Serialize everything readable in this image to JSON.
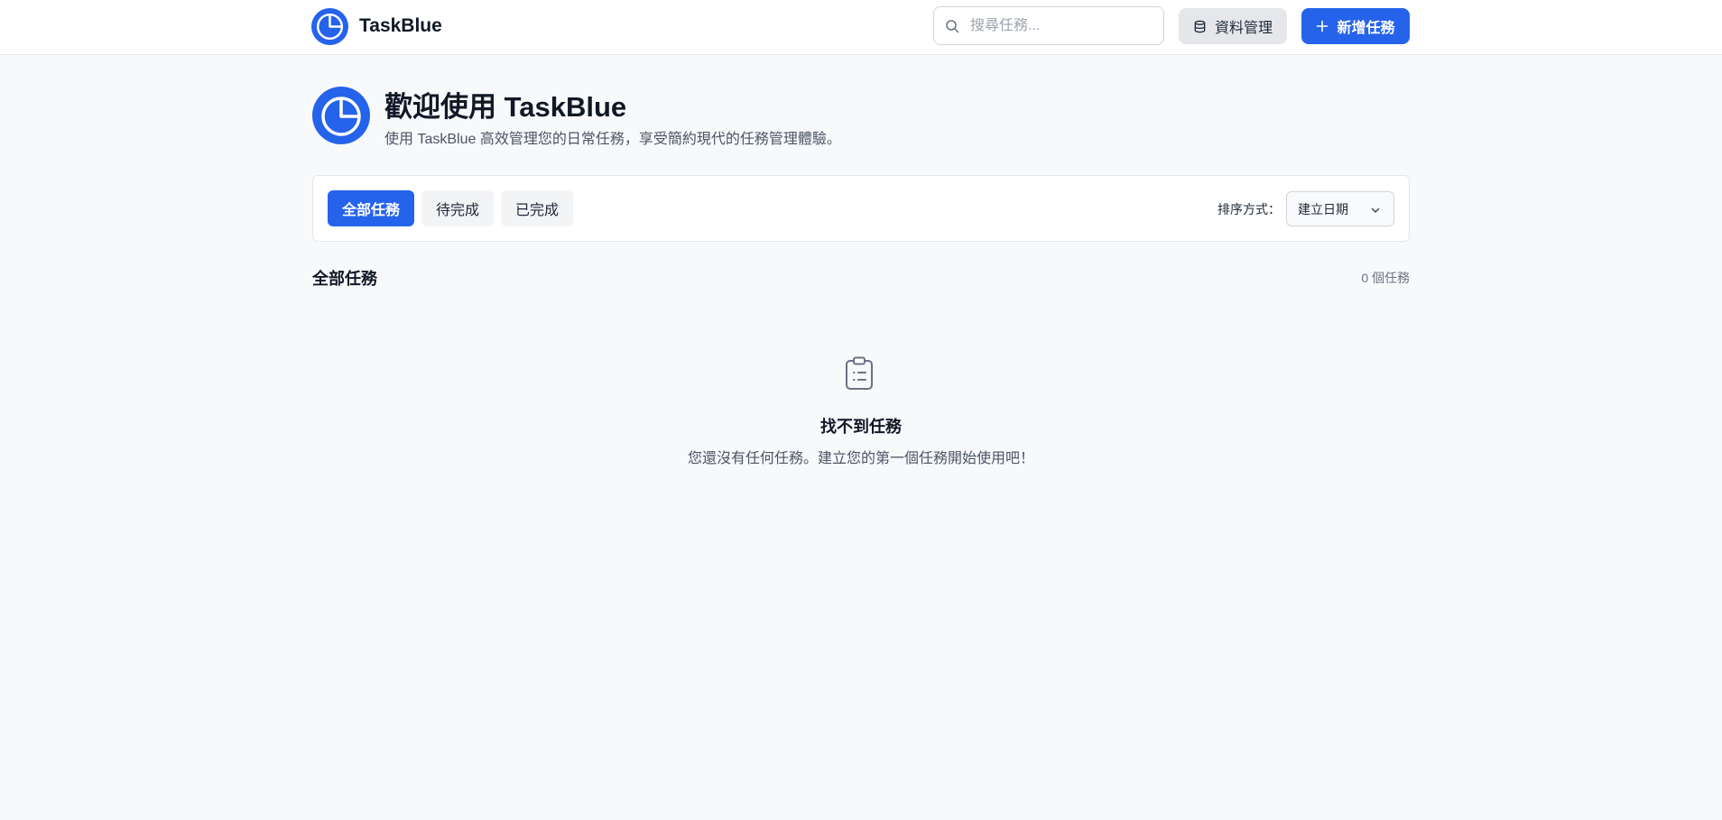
{
  "app": {
    "name": "TaskBlue",
    "logo_icon": "pie-chart-logo-icon",
    "accent": "#2563eb"
  },
  "header": {
    "search": {
      "placeholder": "搜尋任務...",
      "value": "",
      "icon": "search-icon"
    },
    "data_button": {
      "label": "資料管理",
      "icon": "database-icon"
    },
    "new_button": {
      "label": "新增任務",
      "icon": "plus-icon"
    }
  },
  "hero": {
    "title": "歡迎使用 TaskBlue",
    "subtitle": "使用 TaskBlue 高效管理您的日常任務，享受簡約現代的任務管理體驗。"
  },
  "filters": {
    "tabs": [
      {
        "label": "全部任務",
        "active": true
      },
      {
        "label": "待完成",
        "active": false
      },
      {
        "label": "已完成",
        "active": false
      }
    ],
    "sort_label": "排序方式：",
    "sort_value": "建立日期",
    "sort_icon": "chevron-down-icon"
  },
  "list": {
    "title": "全部任務",
    "count": "0 個任務"
  },
  "empty_state": {
    "icon": "clipboard-list-icon",
    "title": "找不到任務",
    "message": "您還沒有任何任務。建立您的第一個任務開始使用吧！"
  }
}
